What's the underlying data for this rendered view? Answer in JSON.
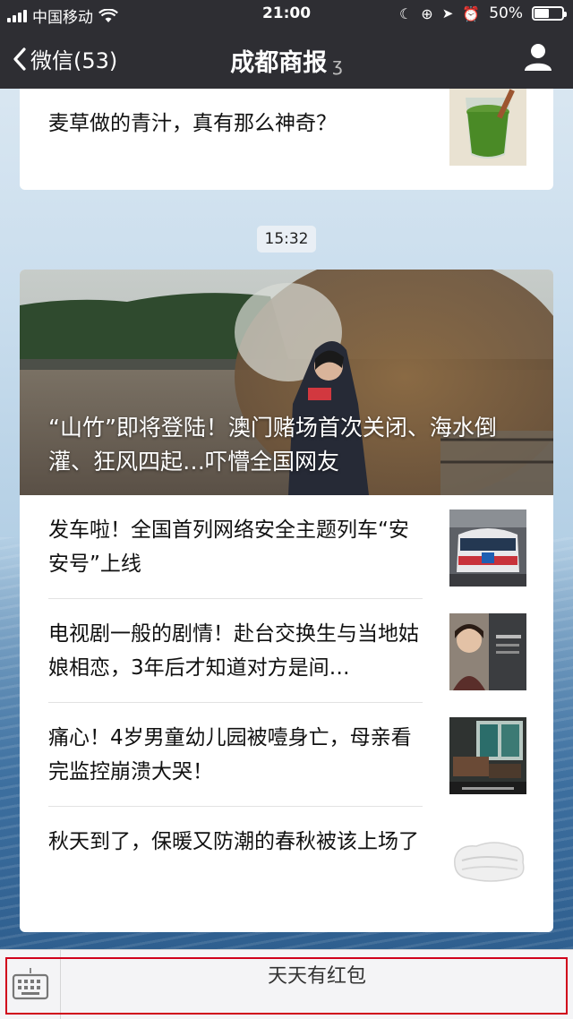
{
  "status_bar": {
    "carrier": "中国移动",
    "time": "21:00",
    "battery": "50%"
  },
  "nav": {
    "back_label": "微信(53)",
    "title": "成都商报"
  },
  "messages": {
    "first_card": {
      "title": "麦草做的青汁，真有那么神奇？"
    },
    "timestamp": "15:32",
    "second_card": {
      "hero_title": "“山竹”即将登陆！澳门赌场首次关闭、海水倒灌、狂风四起…吓懵全国网友",
      "items": [
        {
          "title": "发车啦！全国首列网络安全主题列车“安安号”上线"
        },
        {
          "title": "电视剧一般的剧情！赴台交换生与当地姑娘相恋，3年后才知道对方是间…"
        },
        {
          "title": "痛心！4岁男童幼儿园被噎身亡，母亲看完监控崩溃大哭！"
        },
        {
          "title": "秋天到了，保暖又防潮的春秋被该上场了"
        }
      ]
    }
  },
  "bottom_menu": {
    "label": "天天有红包"
  }
}
